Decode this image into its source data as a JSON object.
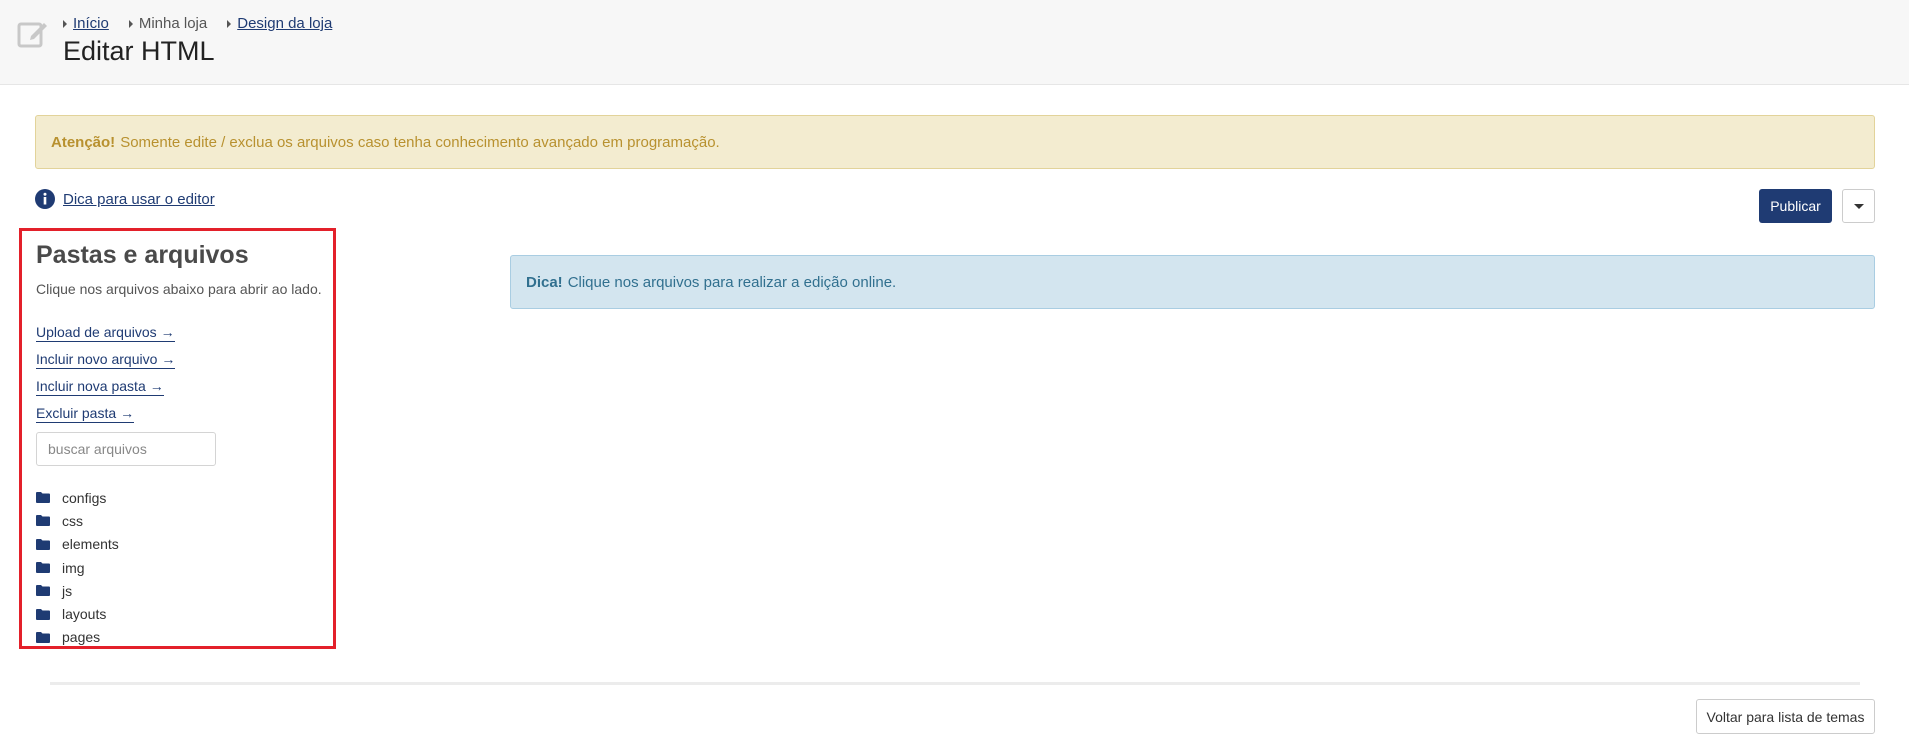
{
  "header": {
    "icon": "edit-icon",
    "breadcrumb": [
      {
        "label": "Início",
        "link": true
      },
      {
        "label": "Minha loja",
        "link": false
      },
      {
        "label": "Design da loja",
        "link": true
      }
    ],
    "title": "Editar HTML"
  },
  "warning": {
    "strong": "Atenção!",
    "text": "Somente edite / exclua os arquivos caso tenha conhecimento avançado em programação."
  },
  "tip_link": {
    "icon": "info-icon",
    "label": "Dica para usar o editor"
  },
  "toolbar": {
    "publish_label": "Publicar",
    "dropdown_icon": "caret-down-icon"
  },
  "files": {
    "title": "Pastas e arquivos",
    "description": "Clique nos arquivos abaixo para abrir ao lado.",
    "actions": [
      {
        "label": "Upload de arquivos",
        "icon": "arrow-right-icon"
      },
      {
        "label": "Incluir novo arquivo",
        "icon": "arrow-right-icon"
      },
      {
        "label": "Incluir nova pasta",
        "icon": "arrow-right-icon"
      },
      {
        "label": "Excluir pasta",
        "icon": "arrow-right-icon"
      }
    ],
    "search_placeholder": "buscar arquivos",
    "folders": [
      "configs",
      "css",
      "elements",
      "img",
      "js",
      "layouts",
      "pages"
    ]
  },
  "info": {
    "strong": "Dica!",
    "text": "Clique nos arquivos para realizar a edição online."
  },
  "footer": {
    "back_label": "Voltar para lista de temas"
  },
  "colors": {
    "primary": "#1f3b73",
    "highlight_border": "#e3202a",
    "warning_bg": "#f3ecd0",
    "warning_text": "#b8912f",
    "info_bg": "#d3e5ef",
    "info_text": "#31708f"
  }
}
